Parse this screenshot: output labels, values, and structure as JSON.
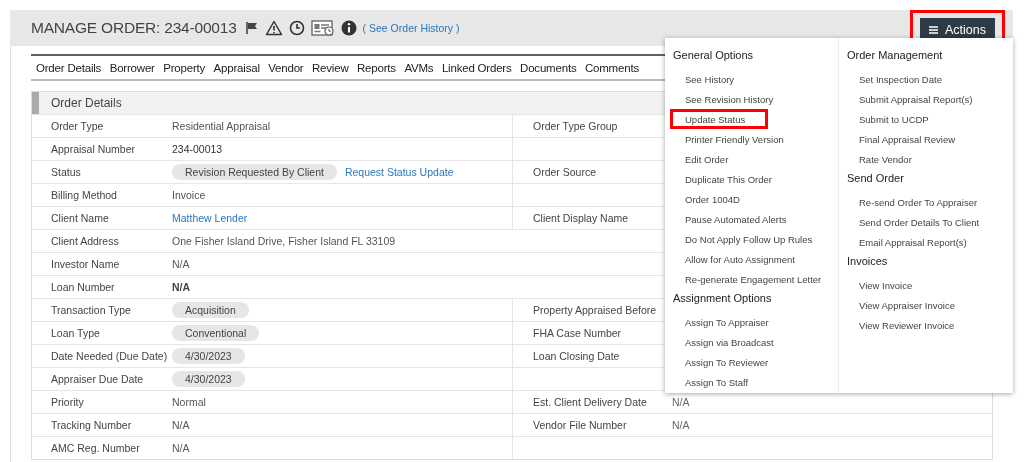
{
  "header": {
    "title": "MANAGE ORDER: 234-00013",
    "history_link": "( See Order History )",
    "actions_button": {
      "label": "Actions",
      "highlighted": true
    }
  },
  "tabs": [
    {
      "label": "Order Details"
    },
    {
      "label": "Borrower"
    },
    {
      "label": "Property"
    },
    {
      "label": "Appraisal"
    },
    {
      "label": "Vendor"
    },
    {
      "label": "Review"
    },
    {
      "label": "Reports"
    },
    {
      "label": "AVMs"
    },
    {
      "label": "Linked Orders"
    },
    {
      "label": "Documents"
    },
    {
      "label": "Comments"
    }
  ],
  "section": {
    "title": "Order Details",
    "rows": [
      {
        "label": "Order Type",
        "value": "Residential Appraisal",
        "kind": "text",
        "label_2": "Order Type Group"
      },
      {
        "label": "Appraisal Number",
        "value": "234-00013",
        "kind": "dark"
      },
      {
        "label": "Status",
        "value": "Revision Requested By Client",
        "kind": "pill",
        "link": "Request Status Update",
        "label_2": "Order Source"
      },
      {
        "label": "Billing Method",
        "value": "Invoice",
        "kind": "text"
      },
      {
        "label": "Client Name",
        "value": "Matthew Lender",
        "kind": "link",
        "label_2": "Client Display Name"
      },
      {
        "label": "Client Address",
        "value": "One Fisher Island Drive, Fisher Island FL 33109",
        "kind": "text",
        "full_width": true
      },
      {
        "label": "Investor Name",
        "value": "N/A",
        "kind": "text",
        "full_width": true
      },
      {
        "label": "Loan Number",
        "value": "N/A",
        "kind": "bold",
        "full_width": true
      },
      {
        "label": "Transaction Type",
        "value": "Acquisition",
        "kind": "pill",
        "label_2": "Property Appraised Before"
      },
      {
        "label": "Loan Type",
        "value": "Conventional",
        "kind": "pill",
        "label_2": "FHA Case Number"
      },
      {
        "label": "Date Needed (Due Date)",
        "value": "4/30/2023",
        "kind": "pill",
        "label_2": "Loan Closing Date"
      },
      {
        "label": "Appraiser Due Date",
        "value": "4/30/2023",
        "kind": "pill"
      },
      {
        "label": "Priority",
        "value": "Normal",
        "kind": "text",
        "label_2": "Est. Client Delivery Date",
        "value_2": "N/A"
      },
      {
        "label": "Tracking Number",
        "value": "N/A",
        "kind": "text",
        "label_2": "Vendor File Number",
        "value_2": "N/A"
      },
      {
        "label": "AMC Reg. Number",
        "value": "N/A",
        "kind": "text"
      }
    ]
  },
  "actions_menu": {
    "columns": [
      [
        {
          "heading": "General Options",
          "items": [
            {
              "label": "See History",
              "highlighted": false
            },
            {
              "label": "See Revision History",
              "highlighted": false
            },
            {
              "label": "Update Status",
              "highlighted": true
            },
            {
              "label": "Printer Friendly Version",
              "highlighted": false
            },
            {
              "label": "Edit Order",
              "highlighted": false
            },
            {
              "label": "Duplicate This Order",
              "highlighted": false
            },
            {
              "label": "Order 1004D",
              "highlighted": false
            },
            {
              "label": "Pause Automated Alerts",
              "highlighted": false
            },
            {
              "label": "Do Not Apply Follow Up Rules",
              "highlighted": false
            },
            {
              "label": "Allow for Auto Assignment",
              "highlighted": false
            },
            {
              "label": "Re-generate Engagement Letter",
              "highlighted": false
            }
          ]
        },
        {
          "heading": "Assignment Options",
          "items": [
            {
              "label": "Assign To Appraiser",
              "highlighted": false
            },
            {
              "label": "Assign via Broadcast",
              "highlighted": false
            },
            {
              "label": "Assign To Reviewer",
              "highlighted": false
            },
            {
              "label": "Assign To Staff",
              "highlighted": false
            }
          ]
        }
      ],
      [
        {
          "heading": "Order Management",
          "items": [
            {
              "label": "Set Inspection Date",
              "highlighted": false
            },
            {
              "label": "Submit Appraisal Report(s)",
              "highlighted": false
            },
            {
              "label": "Submit to UCDP",
              "highlighted": false
            },
            {
              "label": "Final Appraisal Review",
              "highlighted": false
            },
            {
              "label": "Rate Vendor",
              "highlighted": false
            }
          ]
        },
        {
          "heading": "Send Order",
          "items": [
            {
              "label": "Re-send Order To Appraiser",
              "highlighted": false
            },
            {
              "label": "Send Order Details To Client",
              "highlighted": false
            },
            {
              "label": "Email Appraisal Report(s)",
              "highlighted": false
            }
          ]
        },
        {
          "heading": "Invoices",
          "items": [
            {
              "label": "View Invoice",
              "highlighted": false
            },
            {
              "label": "View Appraiser Invoice",
              "highlighted": false
            },
            {
              "label": "View Reviewer Invoice",
              "highlighted": false
            }
          ]
        }
      ]
    ]
  }
}
